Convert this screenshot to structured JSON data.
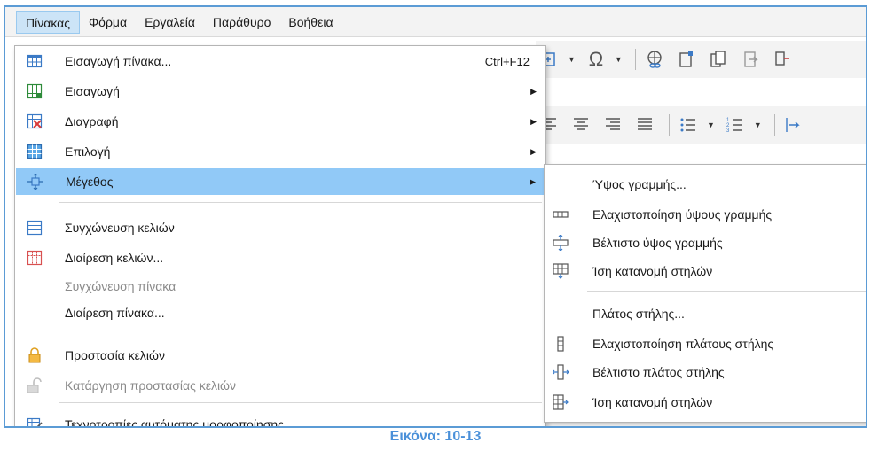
{
  "menubar": {
    "items": [
      "Πίνακας",
      "Φόρμα",
      "Εργαλεία",
      "Παράθυρο",
      "Βοήθεια"
    ]
  },
  "menu": {
    "items": [
      {
        "label": "Εισαγωγή πίνακα...",
        "accel": "Ctrl+F12",
        "icon": "insert-table-icon"
      },
      {
        "label": "Εισαγωγή",
        "submenu": true,
        "icon": "insert-rows-cols-icon"
      },
      {
        "label": "Διαγραφή",
        "submenu": true,
        "icon": "delete-table-icon"
      },
      {
        "label": "Επιλογή",
        "submenu": true,
        "icon": "select-table-icon"
      },
      {
        "label": "Μέγεθος",
        "submenu": true,
        "icon": "size-arrows-icon",
        "highlighted": true
      },
      {
        "label": "Συγχώνευση κελιών",
        "icon": "merge-cells-icon"
      },
      {
        "label": "Διαίρεση κελιών...",
        "icon": "split-cells-icon"
      },
      {
        "label": "Συγχώνευση πίνακα",
        "disabled": true
      },
      {
        "label": "Διαίρεση πίνακα..."
      },
      {
        "label": "Προστασία κελιών",
        "icon": "lock-icon"
      },
      {
        "label": "Κατάργηση προστασίας κελιών",
        "disabled": true,
        "icon": "unlock-icon"
      },
      {
        "label": "Τεχνοτροπίες αυτόματης μορφοποίησης...",
        "icon": "autoformat-icon"
      }
    ]
  },
  "submenu": {
    "items": [
      {
        "label": "Ύψος γραμμής..."
      },
      {
        "label": "Ελαχιστοποίηση ύψους γραμμής",
        "icon": "minimal-row-height-icon"
      },
      {
        "label": "Βέλτιστο ύψος γραμμής",
        "icon": "optimal-row-height-icon"
      },
      {
        "label": "Ίση κατανομή στηλών",
        "icon": "distribute-rows-icon"
      },
      {
        "label": "Πλάτος στήλης..."
      },
      {
        "label": "Ελαχιστοποίηση πλάτους στήλης",
        "icon": "minimal-column-width-icon"
      },
      {
        "label": "Βέλτιστο πλάτος στήλης",
        "icon": "optimal-column-width-icon"
      },
      {
        "label": "Ίση κατανομή στηλών",
        "icon": "distribute-columns-icon"
      }
    ]
  },
  "caption": "Εικόνα: 10-13",
  "colors": {
    "accent": "#5b9bd5",
    "highlight": "#91c9f7",
    "caption": "#4a90d9"
  }
}
